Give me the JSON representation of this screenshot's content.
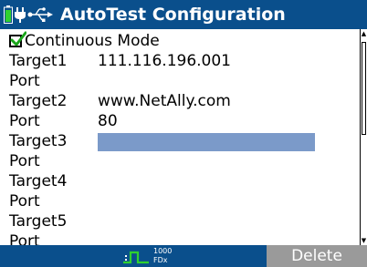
{
  "titlebar": {
    "title": "AutoTest Configuration",
    "icons": [
      "battery-icon",
      "power-plug-icon",
      "usb-icon"
    ]
  },
  "form": {
    "continuous_mode": {
      "label": "Continuous Mode",
      "checked": true
    },
    "rows": [
      {
        "label": "Target1",
        "value": "111.116.196.001"
      },
      {
        "label": "Port",
        "value": ""
      },
      {
        "label": "Target2",
        "value": "www.NetAlly.com"
      },
      {
        "label": "Port",
        "value": "80"
      },
      {
        "label": "Target3",
        "value": ""
      },
      {
        "label": "Port",
        "value": ""
      },
      {
        "label": "Target4",
        "value": ""
      },
      {
        "label": "Port",
        "value": ""
      },
      {
        "label": "Target5",
        "value": ""
      },
      {
        "label": "Port",
        "value": ""
      }
    ]
  },
  "statusbar": {
    "link_speed": "1000",
    "link_duplex": "FDx",
    "delete_label": "Delete"
  },
  "colors": {
    "bar_blue": "#0a4f8c",
    "selected_field": "#7b9ac9",
    "link_green": "#2fd12f",
    "delete_disabled": "#9a9a9a"
  }
}
